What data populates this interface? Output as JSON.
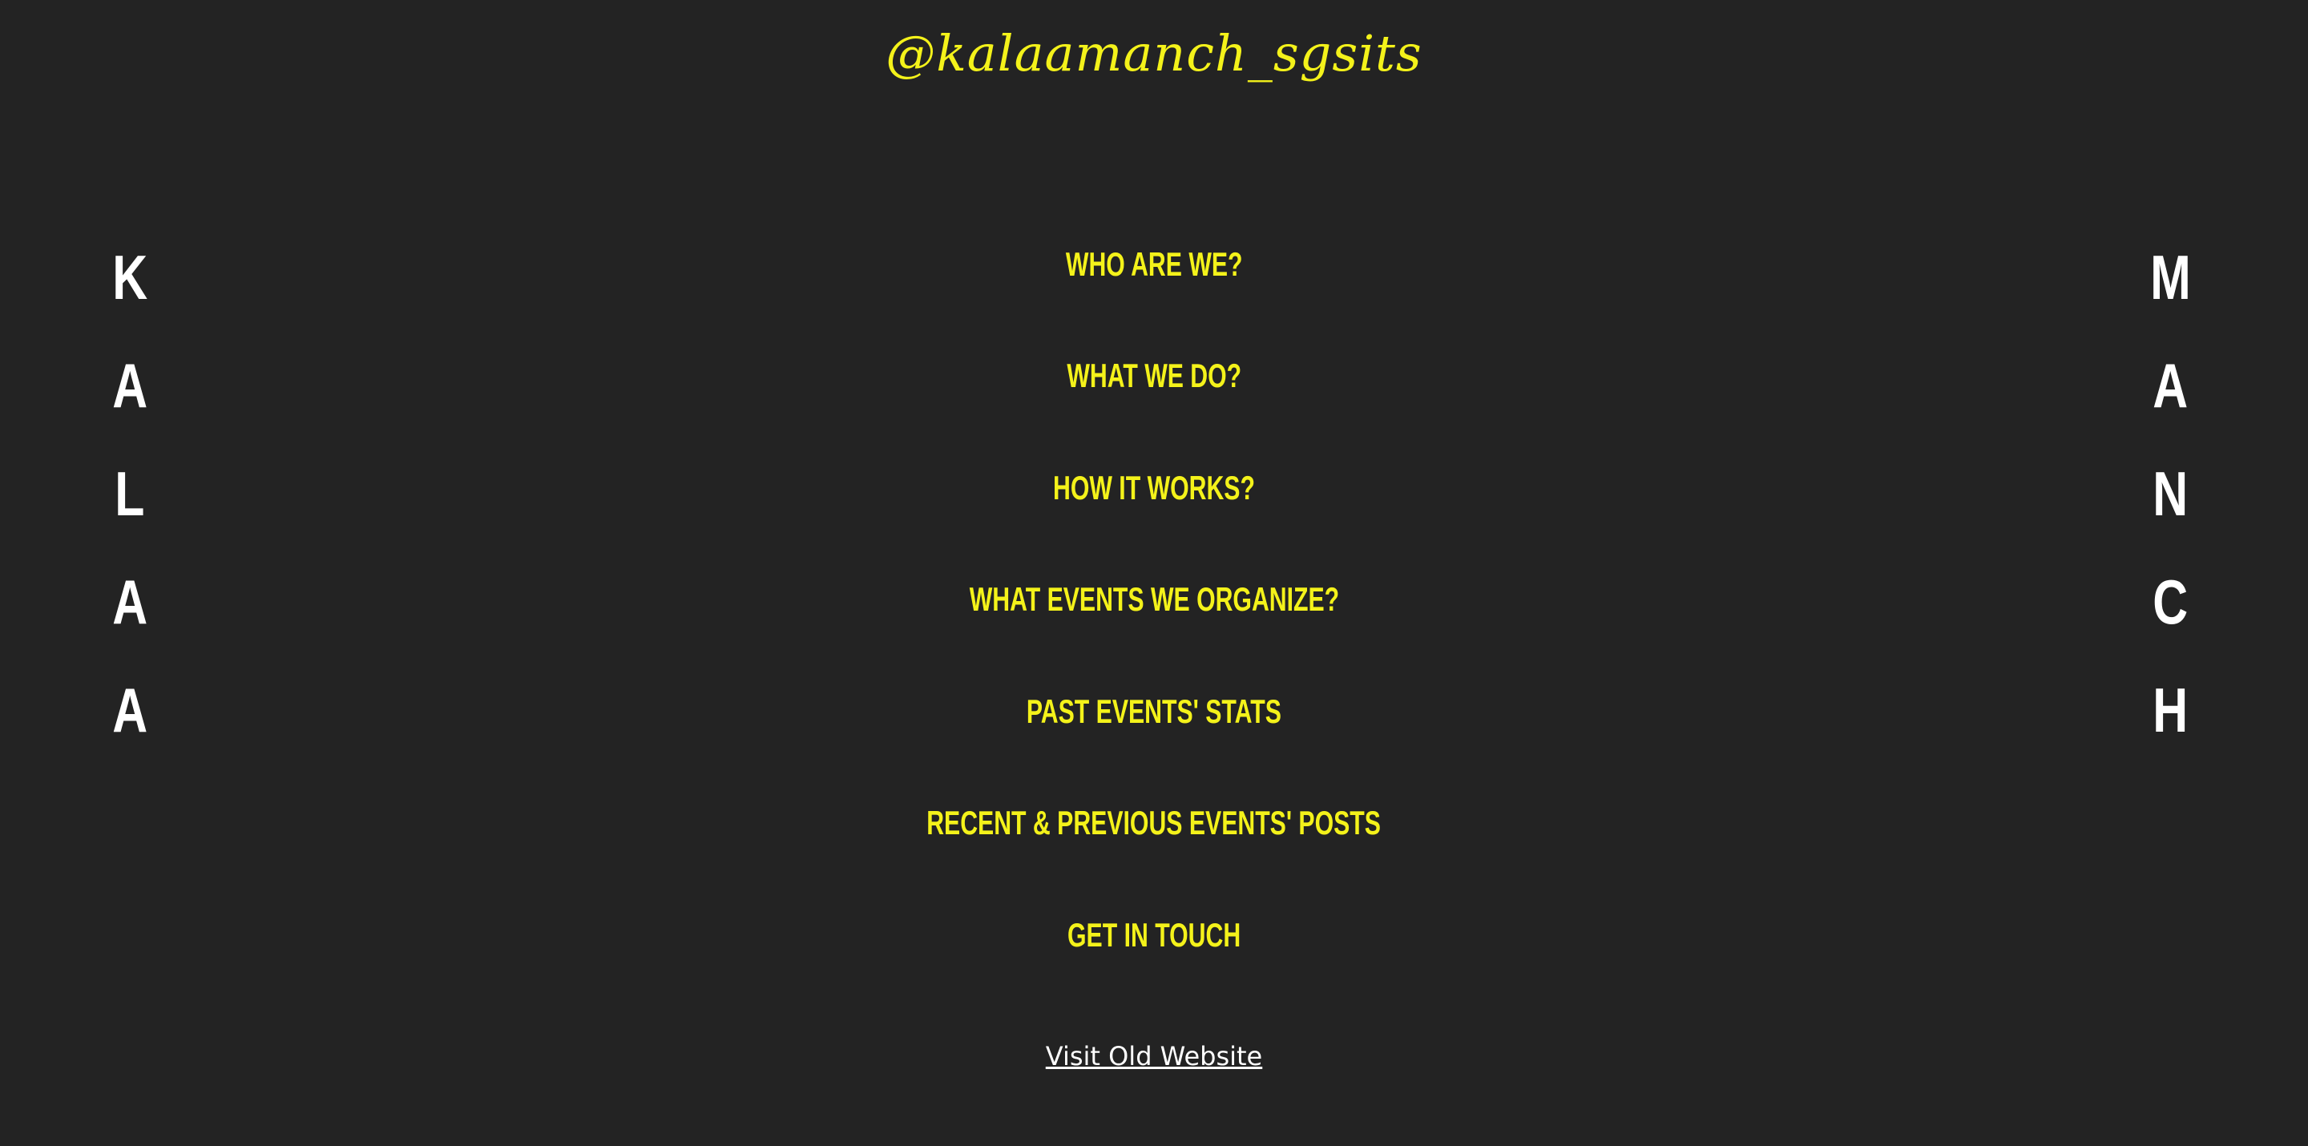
{
  "header": {
    "handle": "@kalaamanch_sgsits"
  },
  "side_left": {
    "letters": [
      "K",
      "A",
      "L",
      "A",
      "A"
    ]
  },
  "side_right": {
    "letters": [
      "M",
      "A",
      "N",
      "C",
      "H"
    ]
  },
  "menu": {
    "items": [
      {
        "label": "WHO ARE WE?"
      },
      {
        "label": "WHAT WE DO?"
      },
      {
        "label": "HOW IT WORKS?"
      },
      {
        "label": "WHAT EVENTS WE ORGANIZE?"
      },
      {
        "label": "PAST EVENTS' STATS"
      },
      {
        "label": "RECENT & PREVIOUS EVENTS' POSTS"
      },
      {
        "label": "GET IN TOUCH"
      }
    ]
  },
  "footer": {
    "old_site_link": "Visit Old Website"
  },
  "colors": {
    "background": "#232323",
    "accent": "#f4f21a",
    "text": "#ffffff"
  }
}
